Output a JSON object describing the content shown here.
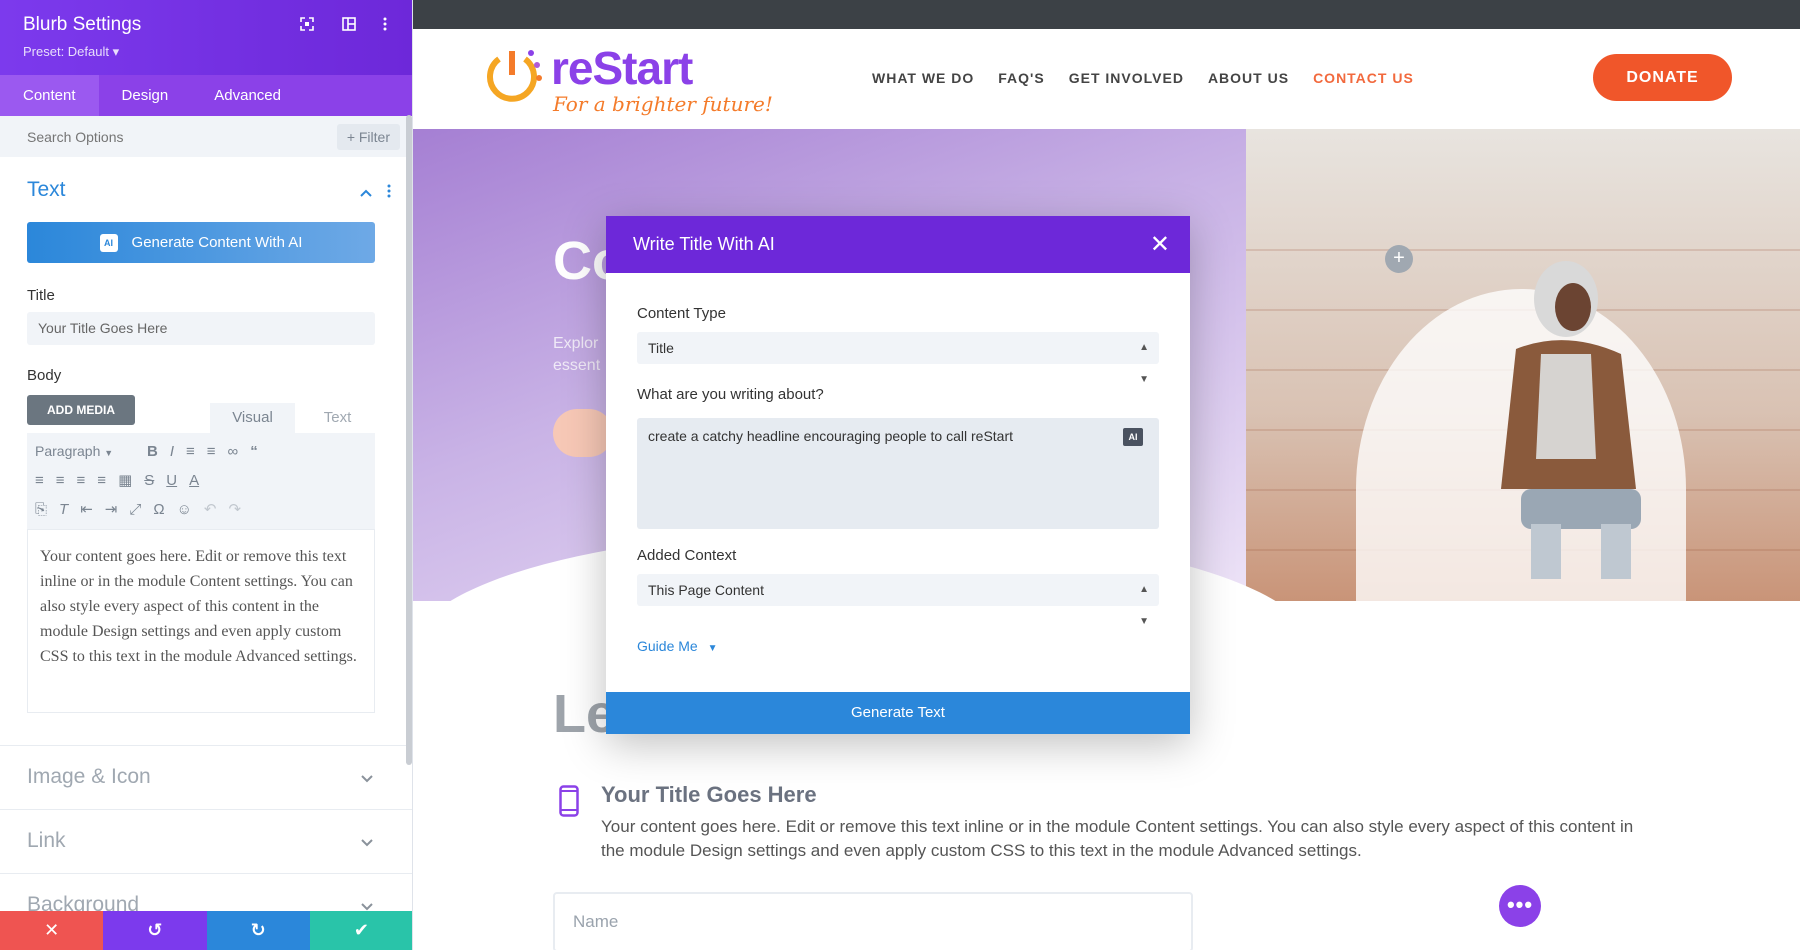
{
  "panel": {
    "title": "Blurb Settings",
    "preset": "Preset: Default ▾",
    "tabs": [
      "Content",
      "Design",
      "Advanced"
    ],
    "search_placeholder": "Search Options",
    "filter_label": "+ Filter",
    "text_section": "Text",
    "ai_button": "Generate Content With AI",
    "ai_chip": "AI",
    "title_label": "Title",
    "title_value": "Your Title Goes Here",
    "body_label": "Body",
    "add_media": "ADD MEDIA",
    "editor_tabs": {
      "visual": "Visual",
      "text": "Text"
    },
    "paragraph_select": "Paragraph",
    "body_text": "Your content goes here. Edit or remove this text inline or in the module Content settings. You can also style every aspect of this content in the module Design settings and even apply custom CSS to this text in the module Advanced settings.",
    "collapsed_sections": [
      "Image & Icon",
      "Link",
      "Background"
    ],
    "bottom_bar": {
      "colors": [
        "#ef5451",
        "#7c3aed",
        "#2b87da",
        "#29c4a9"
      ]
    }
  },
  "site": {
    "logo_text": "reStart",
    "logo_tagline": "For a brighter future!",
    "nav": [
      "WHAT WE DO",
      "FAQ'S",
      "GET INVOLVED",
      "ABOUT US",
      "CONTACT US"
    ],
    "donate": "DONATE",
    "hero_title": "Co",
    "hero_sub_1": "Explor",
    "hero_sub_2": "essent",
    "content_heading": "Le",
    "blurb_title": "Your Title Goes Here",
    "blurb_body": "Your content goes here. Edit or remove this text inline or in the module Content settings. You can also style every aspect of this content in the module Design settings and even apply custom CSS to this text in the module Advanced settings.",
    "name_placeholder": "Name",
    "dots": "•••",
    "plus": "+"
  },
  "modal": {
    "title": "Write Title With AI",
    "close": "✕",
    "content_type_label": "Content Type",
    "content_type_value": "Title",
    "writing_about_label": "What are you writing about?",
    "writing_about_value": "create a catchy headline encouraging people to call reStart",
    "ai_badge": "AI",
    "added_context_label": "Added Context",
    "added_context_value": "This Page Content",
    "guide_me": "Guide Me",
    "generate": "Generate Text"
  },
  "colors": {
    "accent_purple": "#7c3aed",
    "accent_blue": "#2b87da",
    "donate_orange": "#f0562a",
    "nav_active": "#f2693d"
  }
}
